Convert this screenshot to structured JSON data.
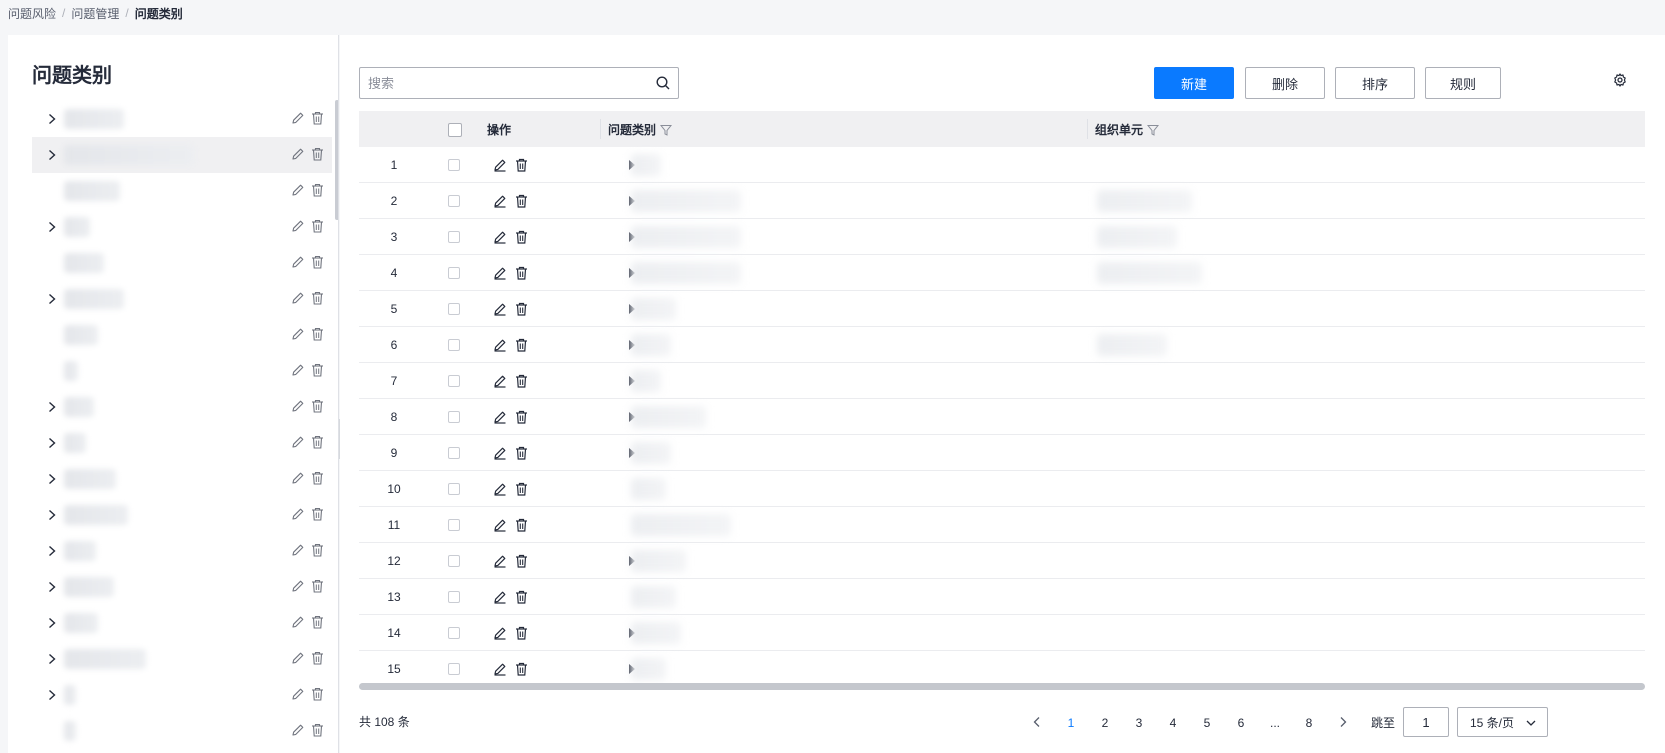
{
  "breadcrumb": {
    "items": [
      "问题风险",
      "问题管理",
      "问题类别"
    ],
    "separator": "/"
  },
  "left": {
    "title": "问题类别",
    "tree": [
      {
        "expandable": true,
        "w": 60
      },
      {
        "expandable": true,
        "w": 130,
        "selected": true
      },
      {
        "expandable": false,
        "w": 56
      },
      {
        "expandable": true,
        "w": 26
      },
      {
        "expandable": false,
        "w": 40
      },
      {
        "expandable": true,
        "w": 60
      },
      {
        "expandable": false,
        "w": 34
      },
      {
        "expandable": false,
        "w": 14
      },
      {
        "expandable": true,
        "w": 30
      },
      {
        "expandable": true,
        "w": 22
      },
      {
        "expandable": true,
        "w": 52
      },
      {
        "expandable": true,
        "w": 64
      },
      {
        "expandable": true,
        "w": 32
      },
      {
        "expandable": true,
        "w": 50
      },
      {
        "expandable": true,
        "w": 34
      },
      {
        "expandable": true,
        "w": 82
      },
      {
        "expandable": true,
        "w": 12
      },
      {
        "expandable": false,
        "w": 12
      }
    ]
  },
  "toolbar": {
    "search_placeholder": "搜索",
    "new_label": "新建",
    "delete_label": "删除",
    "sort_label": "排序",
    "rule_label": "规则"
  },
  "table": {
    "headers": {
      "ops": "操作",
      "category": "问题类别",
      "org": "组织单元"
    },
    "rows": [
      {
        "no": "1",
        "expand": true,
        "cat_w": 30,
        "org_w": 0
      },
      {
        "no": "2",
        "expand": true,
        "cat_w": 110,
        "org_w": 95
      },
      {
        "no": "3",
        "expand": true,
        "cat_w": 110,
        "org_w": 80
      },
      {
        "no": "4",
        "expand": true,
        "cat_w": 110,
        "org_w": 105
      },
      {
        "no": "5",
        "expand": true,
        "cat_w": 45,
        "org_w": 0
      },
      {
        "no": "6",
        "expand": true,
        "cat_w": 40,
        "org_w": 70
      },
      {
        "no": "7",
        "expand": true,
        "cat_w": 30,
        "org_w": 0
      },
      {
        "no": "8",
        "expand": true,
        "cat_w": 75,
        "org_w": 0
      },
      {
        "no": "9",
        "expand": true,
        "cat_w": 40,
        "org_w": 0
      },
      {
        "no": "10",
        "expand": false,
        "cat_w": 35,
        "org_w": 0
      },
      {
        "no": "11",
        "expand": false,
        "cat_w": 100,
        "org_w": 0
      },
      {
        "no": "12",
        "expand": true,
        "cat_w": 55,
        "org_w": 0
      },
      {
        "no": "13",
        "expand": false,
        "cat_w": 45,
        "org_w": 0
      },
      {
        "no": "14",
        "expand": true,
        "cat_w": 50,
        "org_w": 0
      },
      {
        "no": "15",
        "expand": true,
        "cat_w": 35,
        "org_w": 0
      }
    ]
  },
  "pagination": {
    "total": "共 108 条",
    "pages": [
      "1",
      "2",
      "3",
      "4",
      "5",
      "6",
      "...",
      "8"
    ],
    "current": "1",
    "jump_label": "跳至",
    "jump_value": "1",
    "page_size": "15 条/页"
  },
  "colors": {
    "primary": "#0a7aff",
    "header_bg": "#f0f0f2"
  }
}
